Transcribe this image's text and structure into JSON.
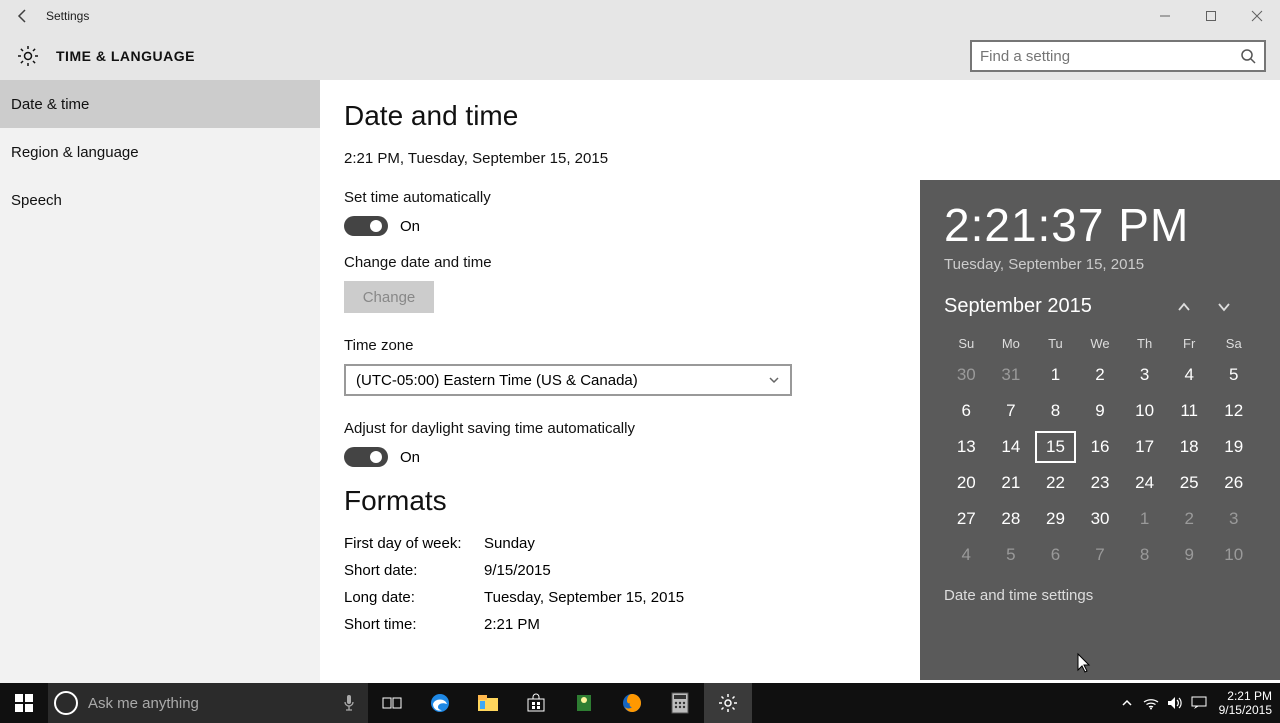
{
  "window": {
    "title": "Settings"
  },
  "header": {
    "label": "TIME & LANGUAGE",
    "search_placeholder": "Find a setting"
  },
  "sidebar": {
    "items": [
      {
        "label": "Date & time",
        "selected": true
      },
      {
        "label": "Region & language",
        "selected": false
      },
      {
        "label": "Speech",
        "selected": false
      }
    ]
  },
  "content": {
    "heading": "Date and time",
    "datetime_line": "2:21 PM, Tuesday, September 15, 2015",
    "auto_time_label": "Set time automatically",
    "auto_time_state": "On",
    "change_label": "Change date and time",
    "change_button": "Change",
    "tz_label": "Time zone",
    "tz_value": "(UTC-05:00) Eastern Time (US & Canada)",
    "dst_label": "Adjust for daylight saving time automatically",
    "dst_state": "On",
    "formats_heading": "Formats",
    "formats": {
      "first_day_k": "First day of week:",
      "first_day_v": "Sunday",
      "short_date_k": "Short date:",
      "short_date_v": "9/15/2015",
      "long_date_k": "Long date:",
      "long_date_v": "Tuesday, September 15, 2015",
      "short_time_k": "Short time:",
      "short_time_v": "2:21 PM"
    }
  },
  "flyout": {
    "time": "2:21:37 PM",
    "date": "Tuesday, September 15, 2015",
    "month": "September 2015",
    "dow": [
      "Su",
      "Mo",
      "Tu",
      "We",
      "Th",
      "Fr",
      "Sa"
    ],
    "grid": [
      [
        {
          "d": "30",
          "dim": true
        },
        {
          "d": "31",
          "dim": true
        },
        {
          "d": "1"
        },
        {
          "d": "2"
        },
        {
          "d": "3"
        },
        {
          "d": "4"
        },
        {
          "d": "5"
        }
      ],
      [
        {
          "d": "6"
        },
        {
          "d": "7"
        },
        {
          "d": "8"
        },
        {
          "d": "9"
        },
        {
          "d": "10"
        },
        {
          "d": "11"
        },
        {
          "d": "12"
        }
      ],
      [
        {
          "d": "13"
        },
        {
          "d": "14"
        },
        {
          "d": "15",
          "today": true
        },
        {
          "d": "16"
        },
        {
          "d": "17"
        },
        {
          "d": "18"
        },
        {
          "d": "19"
        }
      ],
      [
        {
          "d": "20"
        },
        {
          "d": "21"
        },
        {
          "d": "22"
        },
        {
          "d": "23"
        },
        {
          "d": "24"
        },
        {
          "d": "25"
        },
        {
          "d": "26"
        }
      ],
      [
        {
          "d": "27"
        },
        {
          "d": "28"
        },
        {
          "d": "29"
        },
        {
          "d": "30"
        },
        {
          "d": "1",
          "dim": true
        },
        {
          "d": "2",
          "dim": true
        },
        {
          "d": "3",
          "dim": true
        }
      ],
      [
        {
          "d": "4",
          "dim": true
        },
        {
          "d": "5",
          "dim": true
        },
        {
          "d": "6",
          "dim": true
        },
        {
          "d": "7",
          "dim": true
        },
        {
          "d": "8",
          "dim": true
        },
        {
          "d": "9",
          "dim": true
        },
        {
          "d": "10",
          "dim": true
        }
      ]
    ],
    "link": "Date and time settings"
  },
  "taskbar": {
    "search_placeholder": "Ask me anything",
    "clock_time": "2:21 PM",
    "clock_date": "9/15/2015"
  }
}
